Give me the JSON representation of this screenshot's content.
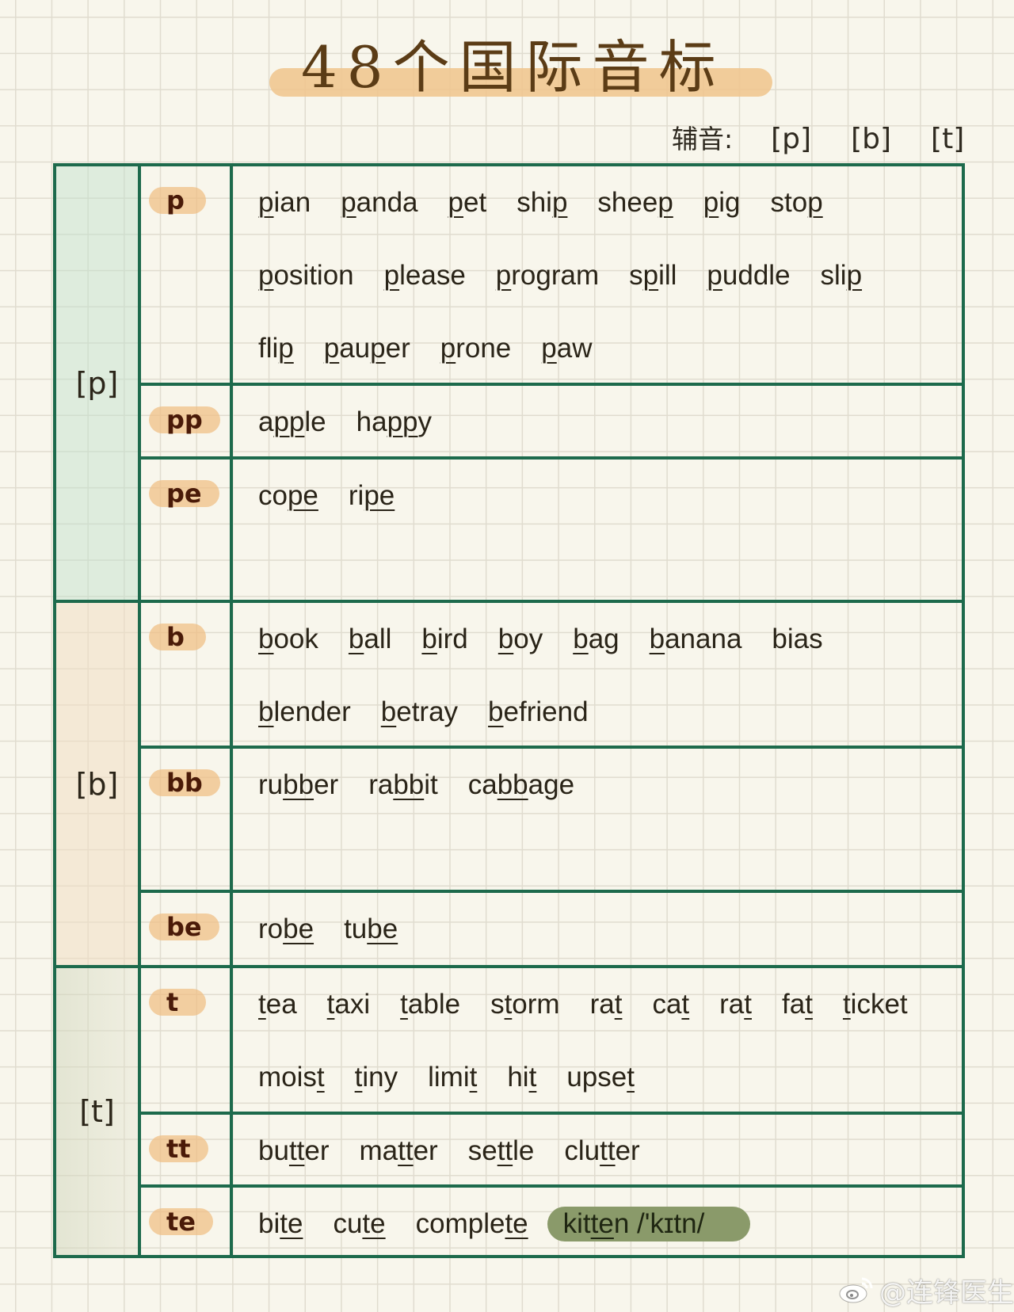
{
  "title": "48个国际音标",
  "subtitle": {
    "label": "辅音:",
    "symbols": [
      "[p]",
      "[b]",
      "[t]"
    ]
  },
  "colors": {
    "border": "#1d6a4c",
    "pill": "#f0be82",
    "title_band": "#f0c48c",
    "highlight": "#8a9a6a",
    "text": "#2a2418"
  },
  "groups": [
    {
      "phoneme": "[p]",
      "rows": [
        {
          "spelling": "p",
          "lines": [
            [
              [
                "",
                "p",
                "ian"
              ],
              [
                "",
                "p",
                "anda"
              ],
              [
                "",
                "p",
                "et"
              ],
              [
                "shi",
                "p",
                ""
              ],
              [
                "shee",
                "p",
                ""
              ],
              [
                "",
                "p",
                "ig"
              ],
              [
                "sto",
                "p",
                ""
              ]
            ],
            [
              [
                "",
                "p",
                "osition"
              ],
              [
                "",
                "p",
                "lease"
              ],
              [
                "",
                "p",
                "rogram"
              ],
              [
                "s",
                "p",
                "ill"
              ],
              [
                "",
                "p",
                "uddle"
              ],
              [
                "sli",
                "p",
                ""
              ]
            ],
            [
              [
                "fli",
                "p",
                ""
              ],
              [
                "",
                "p",
                "au",
                "p",
                "er"
              ],
              [
                "",
                "p",
                "rone"
              ],
              [
                "",
                "p",
                "aw"
              ]
            ]
          ]
        },
        {
          "spelling": "pp",
          "lines": [
            [
              [
                "a",
                "pp",
                "le"
              ],
              [
                "ha",
                "pp",
                "y"
              ]
            ]
          ]
        },
        {
          "spelling": "pe",
          "lines": [
            [
              [
                "co",
                "pe",
                ""
              ],
              [
                "ri",
                "pe",
                ""
              ]
            ]
          ]
        }
      ]
    },
    {
      "phoneme": "[b]",
      "rows": [
        {
          "spelling": "b",
          "lines": [
            [
              [
                "",
                "b",
                "ook"
              ],
              [
                "",
                "b",
                "all"
              ],
              [
                "",
                "b",
                "ird"
              ],
              [
                "",
                "b",
                "oy"
              ],
              [
                "",
                "b",
                "ag"
              ],
              [
                "",
                "b",
                "anana"
              ],
              [
                "bias"
              ]
            ],
            [
              [
                "",
                "b",
                "lender"
              ],
              [
                "",
                "b",
                "etray"
              ],
              [
                "",
                "b",
                "efriend"
              ]
            ]
          ]
        },
        {
          "spelling": "bb",
          "lines": [
            [
              [
                "ru",
                "bb",
                "er"
              ],
              [
                "ra",
                "bb",
                "it"
              ],
              [
                "ca",
                "bb",
                "age"
              ]
            ]
          ]
        },
        {
          "spelling": "be",
          "lines": [
            [
              [
                "ro",
                "be",
                ""
              ],
              [
                "tu",
                "be",
                ""
              ]
            ]
          ]
        }
      ]
    },
    {
      "phoneme": "[t]",
      "rows": [
        {
          "spelling": "t",
          "lines": [
            [
              [
                "",
                "t",
                "ea"
              ],
              [
                "",
                "t",
                "axi"
              ],
              [
                "",
                "t",
                "able"
              ],
              [
                "s",
                "t",
                "orm"
              ],
              [
                "ra",
                "t",
                ""
              ],
              [
                "ca",
                "t",
                ""
              ],
              [
                "ra",
                "t",
                ""
              ],
              [
                "fa",
                "t",
                ""
              ],
              [
                "",
                "t",
                "icket"
              ]
            ],
            [
              [
                "mois",
                "t",
                ""
              ],
              [
                "",
                "t",
                "iny"
              ],
              [
                "limi",
                "t",
                ""
              ],
              [
                "hi",
                "t",
                ""
              ],
              [
                "upse",
                "t",
                ""
              ]
            ]
          ]
        },
        {
          "spelling": "tt",
          "lines": [
            [
              [
                "bu",
                "tt",
                "er"
              ],
              [
                "ma",
                "tt",
                "er"
              ],
              [
                "se",
                "tt",
                "le"
              ],
              [
                "clu",
                "tt",
                "er"
              ]
            ]
          ]
        },
        {
          "spelling": "te",
          "lines": [
            [
              [
                "bi",
                "te",
                ""
              ],
              [
                "cu",
                "te",
                ""
              ],
              [
                "comple",
                "te",
                ""
              ],
              [
                "kit",
                "te",
                "n /'kɪtn/"
              ]
            ]
          ],
          "highlighted_word": "kitten /'kɪtn/"
        }
      ]
    }
  ],
  "watermark": {
    "icon": "weibo-icon",
    "text": "@连锋医生"
  }
}
